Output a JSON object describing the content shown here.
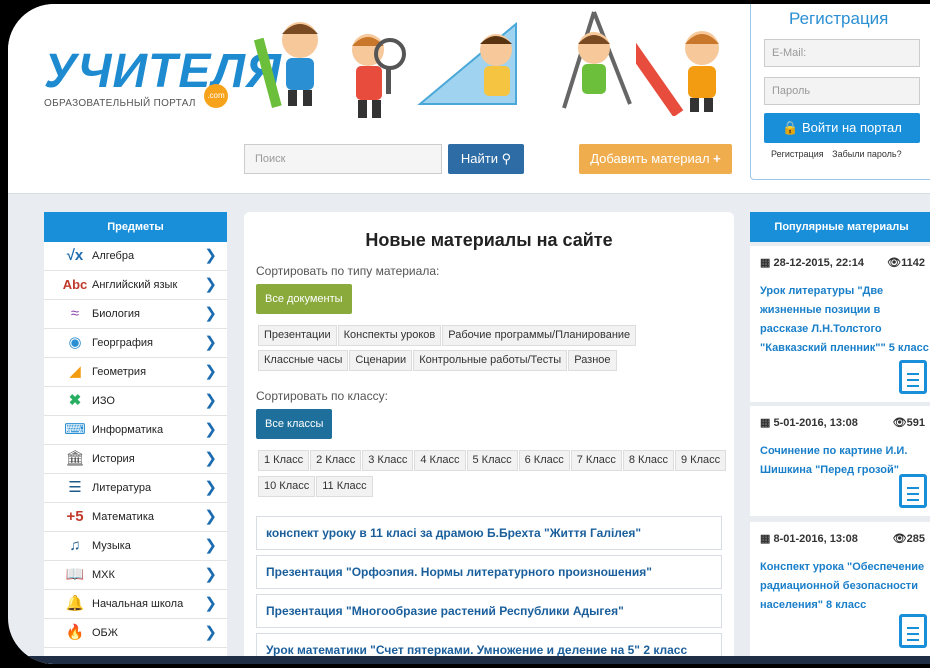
{
  "logo": {
    "text": "УЧИТЕЛЯ",
    "subtitle": "ОБРАЗОВАТЕЛЬНЫЙ ПОРТАЛ",
    "badge": ".com"
  },
  "search": {
    "placeholder": "Поиск",
    "button": "Найти"
  },
  "add_material": "Добавить материал",
  "login": {
    "title": "Регистрация",
    "email_placeholder": "E-Mail:",
    "password_placeholder": "Пароль",
    "button": "Войти на портал",
    "register_link": "Регистрация",
    "forgot_link": "Забыли пароль?"
  },
  "subjects": {
    "title": "Предметы",
    "items": [
      {
        "label": "Алгебра",
        "icon": "sqrt-icon"
      },
      {
        "label": "Английский язык",
        "icon": "abc-icon"
      },
      {
        "label": "Биология",
        "icon": "dna-icon"
      },
      {
        "label": "Георграфия",
        "icon": "globe-icon"
      },
      {
        "label": "Геометрия",
        "icon": "triangle-ruler-icon"
      },
      {
        "label": "ИЗО",
        "icon": "paint-tools-icon"
      },
      {
        "label": "Информатика",
        "icon": "keyboard-icon"
      },
      {
        "label": "История",
        "icon": "temple-icon"
      },
      {
        "label": "Литература",
        "icon": "books-icon"
      },
      {
        "label": "Математика",
        "icon": "plus-five-icon"
      },
      {
        "label": "Музыка",
        "icon": "music-note-icon"
      },
      {
        "label": "МХК",
        "icon": "book-open-icon"
      },
      {
        "label": "Начальная школа",
        "icon": "bell-icon"
      },
      {
        "label": "ОБЖ",
        "icon": "fire-icon"
      }
    ]
  },
  "main": {
    "title": "Новые материалы на сайте",
    "sort_type_label": "Сортировать по типу материала:",
    "all_docs": "Все документы",
    "types_row1": [
      "Презентации",
      "Конспекты уроков",
      "Рабочие программы/Планирование"
    ],
    "types_row2": [
      "Классные часы",
      "Сценарии",
      "Контрольные работы/Тесты",
      "Разное"
    ],
    "sort_class_label": "Сортировать по классу:",
    "all_classes": "Все классы",
    "classes_row1": [
      "1 Класс",
      "2 Класс",
      "3 Класс",
      "4 Класс",
      "5 Класс",
      "6 Класс",
      "7 Класс",
      "8 Класс",
      "9 Класс"
    ],
    "classes_row2": [
      "10 Класс",
      "11 Класс"
    ],
    "materials": [
      "конспект уроку в 11 класі за драмою Б.Брехта \"Життя Галілея\"",
      "Презентация \"Орфоэпия. Нормы литературного произношения\"",
      "Презентация \"Многообразие растений Республики Адыгея\"",
      "Урок математики \"Счет пятерками. Умножение и деление на 5\" 2 класс"
    ]
  },
  "popular": {
    "title": "Популярные материалы",
    "items": [
      {
        "date": "28-12-2015, 22:14",
        "views": "1142",
        "title": "Урок литературы \"Две жизненные позиции в рассказе Л.Н.Толстого \"Кавказский пленник\"\" 5 класс"
      },
      {
        "date": "5-01-2016, 13:08",
        "views": "591",
        "title": "Сочинение по картине И.И. Шишкина \"Перед грозой\""
      },
      {
        "date": "8-01-2016, 13:08",
        "views": "285",
        "title": "Конспект урока \"Обеспечение радиационной безопасности населения\" 8 класс"
      }
    ]
  },
  "colors": {
    "primary": "#1a8fd9",
    "green": "#8aaa3c",
    "teal": "#1e6f9c",
    "orange": "#f0ad4e"
  }
}
